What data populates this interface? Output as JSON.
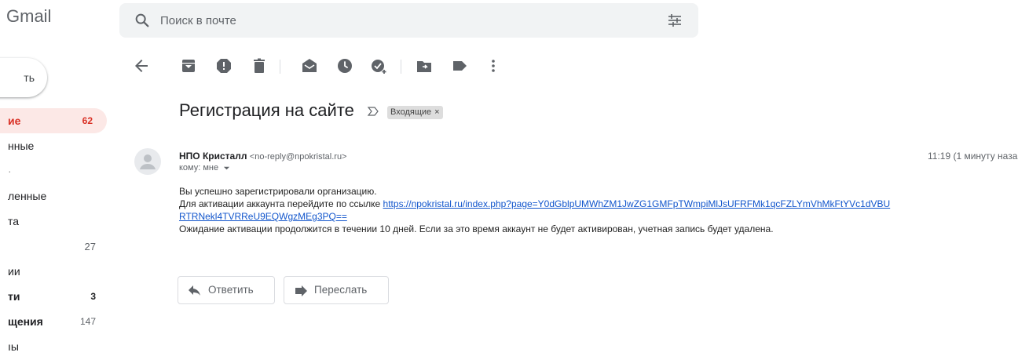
{
  "app": {
    "logo_text": "Gmail"
  },
  "search": {
    "placeholder": "Поиск в почте"
  },
  "compose": {
    "label": "ть"
  },
  "sidebar": {
    "items": [
      {
        "label": "ие",
        "count": "62"
      },
      {
        "label": "нные",
        "count": ""
      },
      {
        "label": "·",
        "count": ""
      },
      {
        "label": "ленные",
        "count": ""
      },
      {
        "label": "та",
        "count": ""
      },
      {
        "label": "",
        "count": "27"
      },
      {
        "label": "ии",
        "count": ""
      },
      {
        "label": "ти",
        "count": "3"
      },
      {
        "label": "щения",
        "count": "147"
      },
      {
        "label": "ıы",
        "count": ""
      }
    ]
  },
  "toolbar": {
    "icons": [
      "back-icon",
      "archive-icon",
      "report-spam-icon",
      "delete-icon",
      "mark-unread-icon",
      "snooze-icon",
      "add-task-icon",
      "move-to-icon",
      "label-icon",
      "more-icon"
    ]
  },
  "message": {
    "subject": "Регистрация на сайте",
    "label_chip": "Входящие",
    "label_chip_close": "×",
    "sender_name": "НПО Кристалл",
    "sender_email": "<no-reply@npokristal.ru>",
    "recipient": "кому: мне",
    "time": "11:19 (1 минуту наза",
    "body_line1": "Вы успешно зарегистрировали организацию.",
    "body_line2_prefix": "Для активации аккаунта перейдите по ссылке ",
    "body_link_part1": "https://npokristal.ru/index.php?page=Y0dGblpUMWhZM1JwZG1GMFpTWmpiMlJsUFRFMk1qcFZLYmVhMkFtYVc1dVBU",
    "body_link_part2": "RTRNekl4TVRReU9EQWgzMEg3PQ==",
    "body_line3": "Ожидание активации продолжится в течении 10 дней. Если за это время аккаунт не будет активирован, учетная запись будет удалена."
  },
  "actions": {
    "reply_label": "Ответить",
    "forward_label": "Переслать"
  },
  "colors": {
    "accent": "#d93025",
    "link": "#1155cc",
    "active_bg": "#fce8e6",
    "search_bg": "#f1f3f4"
  }
}
